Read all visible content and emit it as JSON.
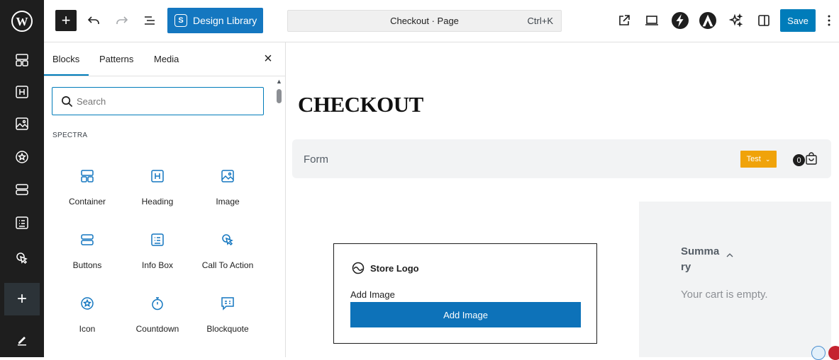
{
  "toolbar": {
    "design_library_label": "Design Library",
    "design_library_badge": "S",
    "command_title": "Checkout · Page",
    "command_shortcut": "Ctrl+K",
    "save_label": "Save"
  },
  "inserter": {
    "tabs": [
      "Blocks",
      "Patterns",
      "Media"
    ],
    "active_tab": "Blocks",
    "search_placeholder": "Search",
    "section_label": "SPECTRA",
    "blocks": [
      {
        "label": "Container",
        "icon": "container-icon"
      },
      {
        "label": "Heading",
        "icon": "heading-icon"
      },
      {
        "label": "Image",
        "icon": "image-icon"
      },
      {
        "label": "Buttons",
        "icon": "buttons-icon"
      },
      {
        "label": "Info Box",
        "icon": "info-box-icon"
      },
      {
        "label": "Call To Action",
        "icon": "call-to-action-icon"
      },
      {
        "label": "Icon",
        "icon": "icon-block-icon"
      },
      {
        "label": "Countdown",
        "icon": "countdown-icon"
      },
      {
        "label": "Blockquote",
        "icon": "blockquote-icon"
      }
    ]
  },
  "canvas": {
    "page_title": "CHECKOUT",
    "form_label": "Form",
    "test_badge": "Test",
    "cart_count": "0",
    "store_logo_label": "Store Logo",
    "add_image_label": "Add Image",
    "add_image_button": "Add Image",
    "summary_title": "Summa ry",
    "cart_empty": "Your cart is empty."
  },
  "colors": {
    "accent": "#007cba",
    "design_library": "#1477c0",
    "rail_bg": "#1e1e1e",
    "test_badge": "#f0a30a"
  }
}
